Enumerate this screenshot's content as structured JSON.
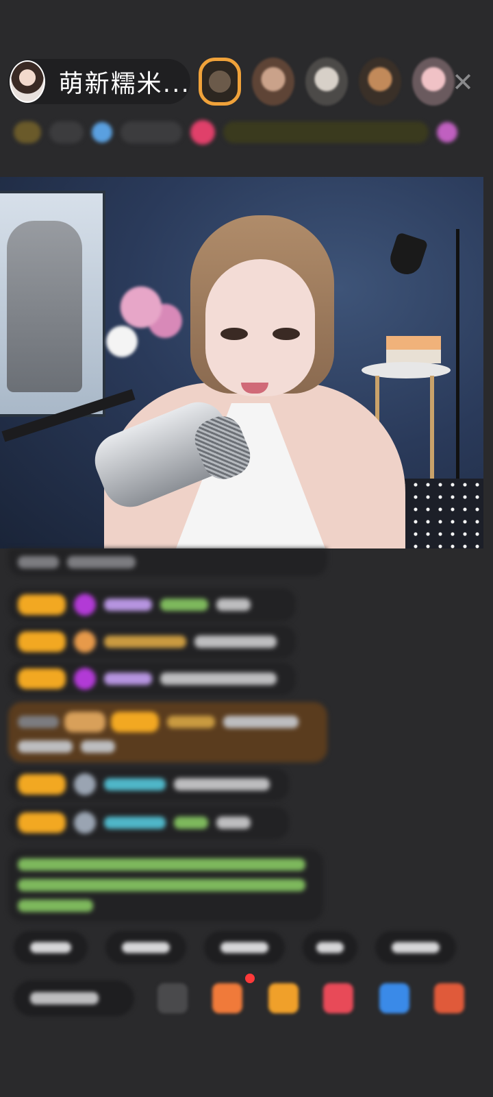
{
  "header": {
    "host_name": "萌新糯米...",
    "close_glyph": "✕"
  },
  "viewers": {
    "avatars": [
      "viewer-avatar-1",
      "viewer-avatar-2",
      "viewer-avatar-3",
      "viewer-avatar-4",
      "viewer-avatar-5"
    ]
  },
  "colors": {
    "background": "#2a2a2c",
    "badge": "#f2a822",
    "highlight_frame": "#f0a23a",
    "notification_dot": "#ff3a3a"
  },
  "icons": [
    "close-icon",
    "emoji-icon",
    "gift-icon",
    "shop-icon",
    "heart-icon",
    "game-icon",
    "grid-icon"
  ]
}
